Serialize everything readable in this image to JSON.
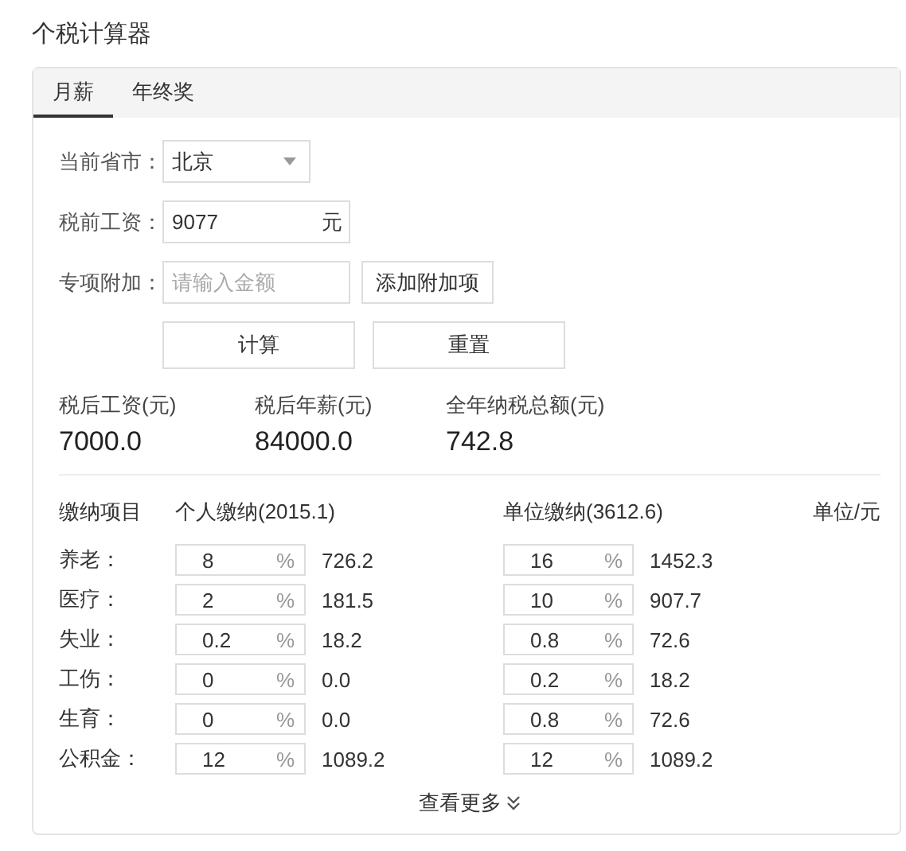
{
  "title": "个税计算器",
  "tabs": [
    {
      "label": "月薪",
      "selected": true
    },
    {
      "label": "年终奖",
      "selected": false
    }
  ],
  "form": {
    "province": {
      "label": "当前省市：",
      "value": "北京"
    },
    "salary": {
      "label": "税前工资：",
      "value": "9077",
      "unit": "元"
    },
    "deduction": {
      "label": "专项附加：",
      "placeholder": "请输入金额",
      "button": "添加附加项"
    },
    "buttons": [
      "计算",
      "重置"
    ]
  },
  "results": [
    {
      "label": "税后工资(元)",
      "value": "7000.0"
    },
    {
      "label": "税后年薪(元)",
      "value": "84000.0"
    },
    {
      "label": "全年纳税总额(元)",
      "value": "742.8"
    }
  ],
  "table": {
    "columns": [
      "缴纳项目",
      "个人缴纳(2015.1)",
      "单位缴纳(3612.6)"
    ],
    "unit_note": "单位/元",
    "rows": [
      {
        "label": "养老：",
        "personal_rate": "8",
        "personal_unit": "%",
        "personal_amount": "726.2",
        "company_rate": "16",
        "company_unit": "%",
        "company_amount": "1452.3"
      },
      {
        "label": "医疗：",
        "personal_rate": "2",
        "personal_unit": "%",
        "personal_amount": "181.5",
        "company_rate": "10",
        "company_unit": "%",
        "company_amount": "907.7"
      },
      {
        "label": "失业：",
        "personal_rate": "0.2",
        "personal_unit": "%",
        "personal_amount": "18.2",
        "company_rate": "0.8",
        "company_unit": "%",
        "company_amount": "72.6"
      },
      {
        "label": "工伤：",
        "personal_rate": "0",
        "personal_unit": "%",
        "personal_amount": "0.0",
        "company_rate": "0.2",
        "company_unit": "%",
        "company_amount": "18.2"
      },
      {
        "label": "生育：",
        "personal_rate": "0",
        "personal_unit": "%",
        "personal_amount": "0.0",
        "company_rate": "0.8",
        "company_unit": "%",
        "company_amount": "72.6"
      },
      {
        "label": "公积金：",
        "personal_rate": "12",
        "personal_unit": "%",
        "personal_amount": "1089.2",
        "company_rate": "12",
        "company_unit": "%",
        "company_amount": "1089.2"
      }
    ]
  },
  "more_link": "查看更多"
}
